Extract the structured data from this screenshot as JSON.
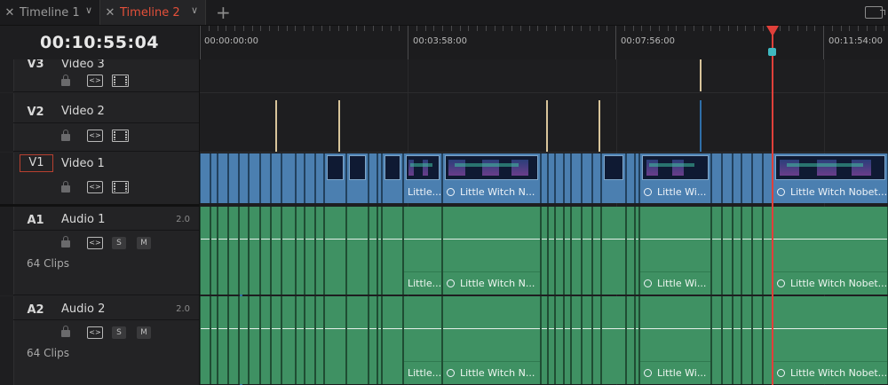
{
  "tabs": [
    {
      "label": "Timeline 1",
      "active": false
    },
    {
      "label": "Timeline 2",
      "active": true
    }
  ],
  "add_tab_label": "+",
  "icons": {
    "close": "close-icon",
    "chevron": "chevron-down-icon",
    "add": "plus-icon",
    "lock": "lock-icon",
    "auto_select": "auto-select-icon",
    "video_toggle": "film-icon",
    "solo": "S",
    "mute": "M"
  },
  "timecode": "00:10:55:04",
  "ruler": {
    "labels": [
      "00:00:00:00",
      "00:03:58:00",
      "00:07:56:00",
      "00:11:54:00"
    ]
  },
  "tracks": {
    "v3": {
      "id": "V3",
      "name": "Video 3"
    },
    "v2": {
      "id": "V2",
      "name": "Video 2"
    },
    "v1": {
      "id": "V1",
      "name": "Video 1"
    },
    "a1": {
      "id": "A1",
      "name": "Audio 1",
      "channels": "2.0",
      "clips": "64 Clips",
      "solo": "S",
      "mute": "M"
    },
    "a2": {
      "id": "A2",
      "name": "Audio 2",
      "channels": "2.0",
      "clips": "64 Clips",
      "solo": "S",
      "mute": "M"
    }
  },
  "clip_labels": {
    "c1": "Little...",
    "c2": "Little Witch N...",
    "c3": "Little Wi...",
    "c4": "Little Witch Nobet..."
  },
  "colors": {
    "accent": "#e0403a",
    "video": "#4b7fb0",
    "audio": "#3f9163",
    "marker": "#3fb8c0"
  }
}
